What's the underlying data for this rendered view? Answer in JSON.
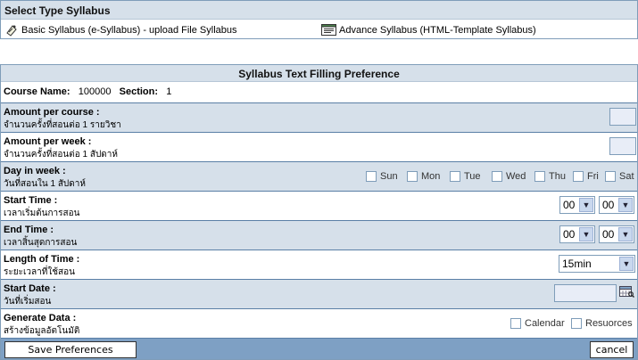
{
  "type_panel": {
    "title": "Select Type Syllabus",
    "basic_label": "Basic Syllabus (e-Syllabus) - upload File Syllabus",
    "advance_label": "Advance Syllabus (HTML-Template Syllabus)"
  },
  "pref": {
    "title": "Syllabus Text Filling Preference",
    "course_name_label": "Course Name:",
    "course_name_value": "100000",
    "section_label": "Section:",
    "section_value": "1",
    "amount_course": {
      "en": "Amount per course :",
      "th": "จำนวนครั้งที่สอนต่อ 1 รายวิชา",
      "value": ""
    },
    "amount_week": {
      "en": "Amount per week :",
      "th": "จำนวนครั้งที่สอนต่อ 1 สัปดาห์",
      "value": ""
    },
    "day_in_week": {
      "en": "Day in week :",
      "th": "วันที่สอนใน 1 สัปดาห์",
      "days": [
        "Sun",
        "Mon",
        "Tue",
        "Wed",
        "Thu",
        "Fri",
        "Sat"
      ]
    },
    "start_time": {
      "en": "Start Time :",
      "th": "เวลาเริ่มต้นการสอน",
      "hour": "00",
      "minute": "00"
    },
    "end_time": {
      "en": "End Time :",
      "th": "เวลาสิ้นสุดการสอน",
      "hour": "00",
      "minute": "00"
    },
    "length": {
      "en": "Length of Time :",
      "th": "ระยะเวลาที่ใช้สอน",
      "value": "15min"
    },
    "start_date": {
      "en": "Start Date :",
      "th": "วันที่เริ่มสอน",
      "value": ""
    },
    "generate": {
      "en": "Generate Data :",
      "th": "สร้างข้อมูลอัตโนมัติ",
      "opt1": "Calendar",
      "opt2": "Resuorces"
    }
  },
  "footer": {
    "save_label": "Save Preferences",
    "cancel_label": "cancel"
  }
}
